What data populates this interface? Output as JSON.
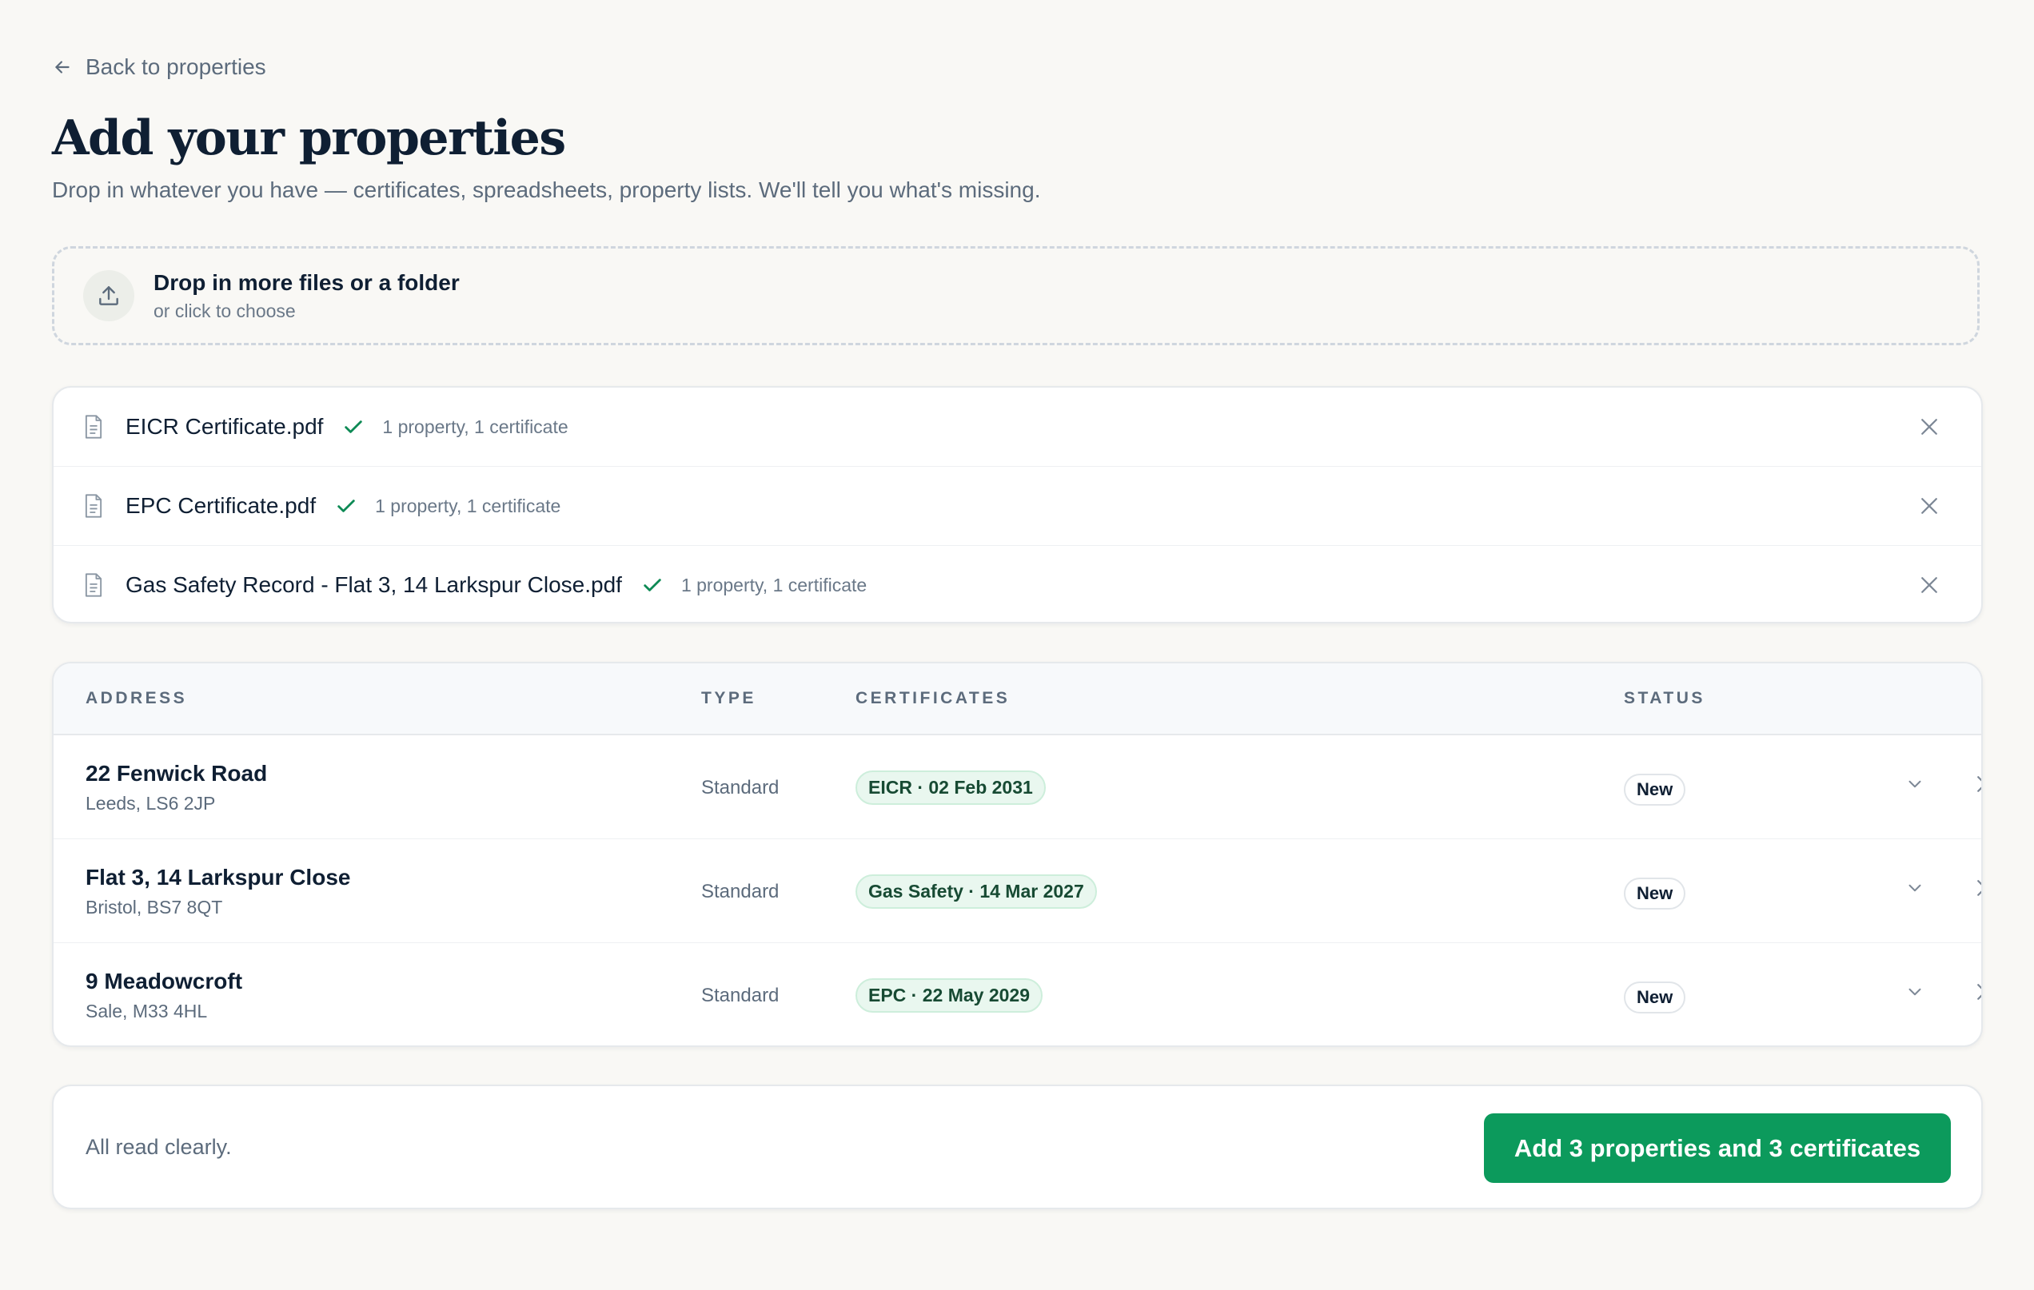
{
  "nav": {
    "back_label": "Back to properties"
  },
  "header": {
    "title": "Add your properties",
    "subtitle": "Drop in whatever you have — certificates, spreadsheets, property lists. We'll tell you what's missing."
  },
  "dropzone": {
    "title": "Drop in more files or a folder",
    "subtitle": "or click to choose",
    "icon": "upload-icon"
  },
  "files": [
    {
      "name": "EICR Certificate.pdf",
      "meta": "1 property, 1 certificate",
      "status": "check-icon"
    },
    {
      "name": "EPC Certificate.pdf",
      "meta": "1 property, 1 certificate",
      "status": "check-icon"
    },
    {
      "name": "Gas Safety Record - Flat 3, 14 Larkspur Close.pdf",
      "meta": "1 property, 1 certificate",
      "status": "check-icon"
    }
  ],
  "table": {
    "headers": {
      "address": "ADDRESS",
      "type": "TYPE",
      "certificates": "CERTIFICATES",
      "status": "STATUS"
    },
    "rows": [
      {
        "address_line1": "22 Fenwick Road",
        "address_line2": "Leeds, LS6 2JP",
        "type": "Standard",
        "certificate": "EICR · 02 Feb 2031",
        "status": "New"
      },
      {
        "address_line1": "Flat 3, 14 Larkspur Close",
        "address_line2": "Bristol, BS7 8QT",
        "type": "Standard",
        "certificate": "Gas Safety · 14 Mar 2027",
        "status": "New"
      },
      {
        "address_line1": "9 Meadowcroft",
        "address_line2": "Sale, M33 4HL",
        "type": "Standard",
        "certificate": "EPC · 22 May 2029",
        "status": "New"
      }
    ]
  },
  "footer": {
    "message": "All read clearly.",
    "submit_label": "Add 3 properties and 3 certificates"
  },
  "colors": {
    "background": "#f9f8f5",
    "accent": "#0c9a5c",
    "check": "#0e8a55",
    "chip_bg": "#e9f7ef",
    "text_primary": "#0f1f33",
    "text_muted": "#5c6b7c"
  }
}
